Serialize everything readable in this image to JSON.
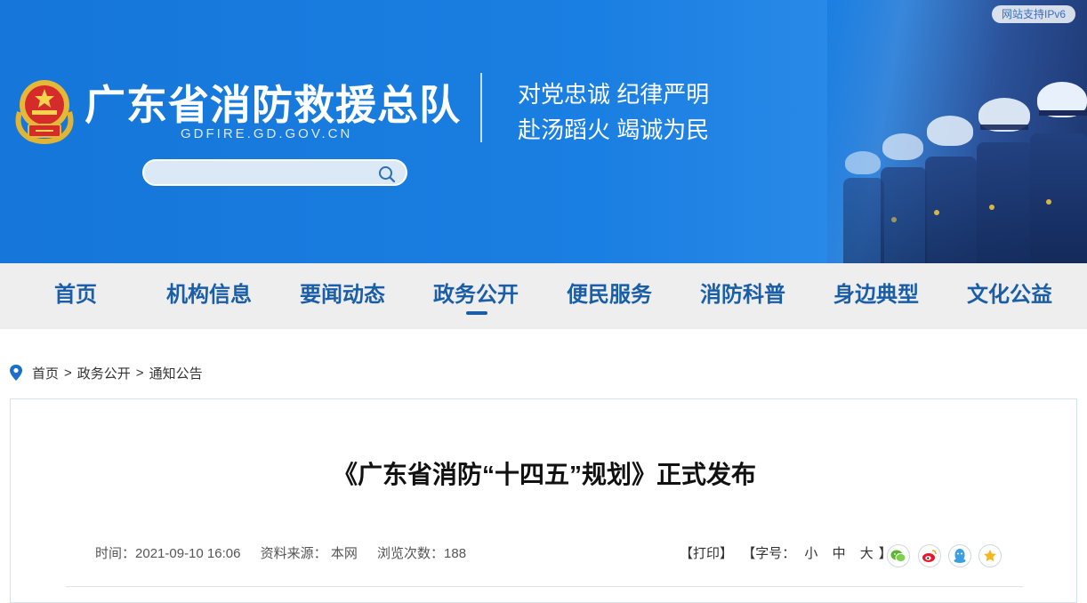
{
  "banner": {
    "ipv6_label": "网站支持IPv6",
    "site_title": "广东省消防救援总队",
    "site_domain": "GDFIRE.GD.GOV.CN",
    "slogan_line1": "对党忠诚 纪律严明",
    "slogan_line2": "赴汤蹈火 竭诚为民",
    "search_placeholder": "",
    "search_icon": "search-icon",
    "emblem_icon": "fire-rescue-emblem-icon",
    "colors": {
      "banner_blue": "#1a7fe2",
      "nav_text": "#1a5ea8"
    }
  },
  "nav": {
    "items": [
      {
        "label": "首页"
      },
      {
        "label": "机构信息"
      },
      {
        "label": "要闻动态"
      },
      {
        "label": "政务公开",
        "active": true
      },
      {
        "label": "便民服务"
      },
      {
        "label": "消防科普"
      },
      {
        "label": "身边典型"
      },
      {
        "label": "文化公益"
      }
    ]
  },
  "breadcrumb": {
    "icon": "location-pin-icon",
    "items": [
      "首页",
      "政务公开",
      "通知公告"
    ],
    "separator": ">"
  },
  "article": {
    "title": "《广东省消防“十四五”规划》正式发布",
    "time_label": "时间：",
    "time_value": "2021-09-10 16:06",
    "source_label": "资料来源：",
    "source_value": "本网",
    "views_label": "浏览次数：",
    "views_value": "188",
    "print_label": "【打印】",
    "font_size_label": "【字号：",
    "font_size_options": [
      "小",
      "中",
      "大"
    ],
    "font_size_close": "】",
    "share_icons": [
      "wechat-icon",
      "weibo-icon",
      "qq-icon",
      "favorite-icon"
    ]
  }
}
